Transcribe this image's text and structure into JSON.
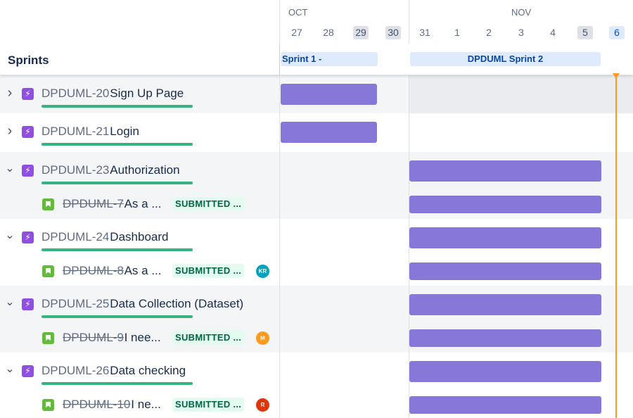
{
  "timeline": {
    "months": [
      {
        "label": "OCT"
      },
      {
        "label": "NOV"
      }
    ],
    "days": [
      {
        "label": "27",
        "kind": "normal"
      },
      {
        "label": "28",
        "kind": "normal"
      },
      {
        "label": "29",
        "kind": "weekend"
      },
      {
        "label": "30",
        "kind": "weekend"
      },
      {
        "label": "31",
        "kind": "normal"
      },
      {
        "label": "1",
        "kind": "normal"
      },
      {
        "label": "2",
        "kind": "normal"
      },
      {
        "label": "3",
        "kind": "normal"
      },
      {
        "label": "4",
        "kind": "normal"
      },
      {
        "label": "5",
        "kind": "weekend"
      },
      {
        "label": "6",
        "kind": "today"
      }
    ]
  },
  "sprints": {
    "title": "Sprints",
    "items": [
      {
        "label": "Sprint 1 -"
      },
      {
        "label": "DPDUML Sprint 2"
      }
    ]
  },
  "rows": [
    {
      "type": "epic",
      "expanded": false,
      "key": "DPDUML-20",
      "summary": "Sign Up Page"
    },
    {
      "type": "epic",
      "expanded": false,
      "key": "DPDUML-21",
      "summary": "Login"
    },
    {
      "type": "epic",
      "expanded": true,
      "key": "DPDUML-23",
      "summary": "Authorization"
    },
    {
      "type": "story",
      "key": "DPDUML-7",
      "summary": "As a ...",
      "status": "SUBMITTED ...",
      "avatar": {
        "initials": "",
        "color": "#e34935",
        "icon": "broken-avatar-icon"
      }
    },
    {
      "type": "epic",
      "expanded": true,
      "key": "DPDUML-24",
      "summary": "Dashboard"
    },
    {
      "type": "story",
      "key": "DPDUML-8",
      "summary": "As a ...",
      "status": "SUBMITTED ...",
      "avatar": {
        "initials": "KR",
        "color": "#00a3bf"
      }
    },
    {
      "type": "epic",
      "expanded": true,
      "key": "DPDUML-25",
      "summary": "Data Collection (Dataset)"
    },
    {
      "type": "story",
      "key": "DPDUML-9",
      "summary": "I nee...",
      "status": "SUBMITTED ...",
      "avatar": {
        "initials": "M",
        "color": "#ff991f"
      }
    },
    {
      "type": "epic",
      "expanded": true,
      "key": "DPDUML-26",
      "summary": "Data checking"
    },
    {
      "type": "story",
      "key": "DPDUML-10",
      "summary": "I ne...",
      "status": "SUBMITTED ...",
      "avatar": {
        "initials": "R",
        "color": "#de350b"
      }
    }
  ],
  "colors": {
    "epic": "#904ee2",
    "story": "#63ba3c",
    "bar": "#8777d9",
    "progress": "#36b37e",
    "today": "#ff991f",
    "status_text": "#006644",
    "status_bg": "#e3fcef"
  }
}
